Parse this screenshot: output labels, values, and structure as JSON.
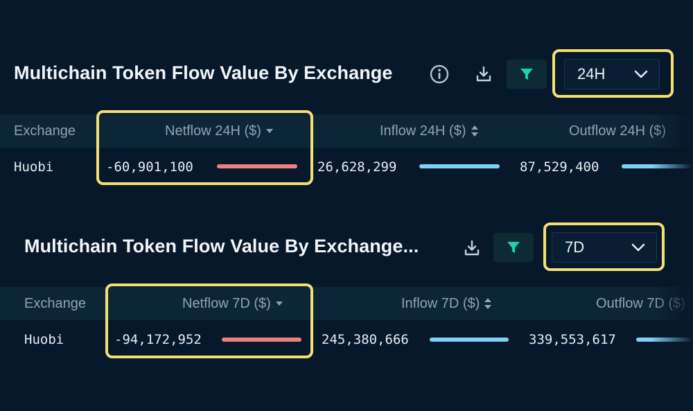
{
  "panels": [
    {
      "title": "Multichain Token Flow Value By Exchange",
      "period": "24H",
      "columns": {
        "exchange": "Exchange",
        "netflow": "Netflow 24H ($)",
        "inflow": "Inflow 24H ($)",
        "outflow": "Outflow 24H ($)"
      },
      "rows": [
        {
          "exchange": "Huobi",
          "netflow": "-60,901,100",
          "inflow": "26,628,299",
          "outflow": "87,529,400"
        }
      ]
    },
    {
      "title": "Multichain Token Flow Value By Exchange...",
      "period": "7D",
      "columns": {
        "exchange": "Exchange",
        "netflow": "Netflow 7D ($)",
        "inflow": "Inflow 7D ($)",
        "outflow": "Outflow 7D ($)"
      },
      "rows": [
        {
          "exchange": "Huobi",
          "netflow": "-94,172,952",
          "inflow": "245,380,666",
          "outflow": "339,553,617"
        }
      ]
    }
  ],
  "icons": {
    "info": "info-icon",
    "download": "download-icon",
    "filter": "filter-icon",
    "dropdown": "chevron-down-icon",
    "sort_desc": "sort-descending-icon",
    "sort_both": "sort-icon"
  },
  "colors": {
    "background": "#07182a",
    "table_header": "#0c2638",
    "highlight": "#f4df72",
    "negative_bar": "#ef7f7e",
    "positive_bar": "#7fd0f6",
    "filter_accent": "#1ed3a6"
  }
}
